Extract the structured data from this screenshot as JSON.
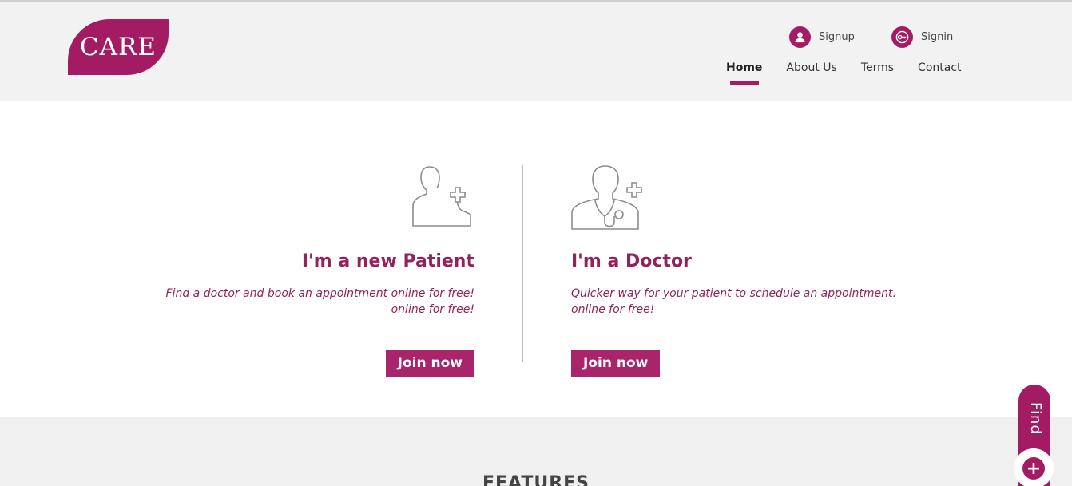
{
  "brand": {
    "logo_text": "CARE",
    "accent_color": "#a31c63"
  },
  "auth": {
    "signup_label": "Signup",
    "signin_label": "Signin",
    "signup_icon": "user-icon",
    "signin_icon": "key-icon"
  },
  "nav": {
    "items": [
      {
        "label": "Home",
        "active": true
      },
      {
        "label": "About Us",
        "active": false
      },
      {
        "label": "Terms",
        "active": false
      },
      {
        "label": "Contact",
        "active": false
      }
    ]
  },
  "patient": {
    "icon": "patient-add-icon",
    "title": "I'm a new Patient",
    "description_line1": "Find a doctor and book an appointment online for free!",
    "description_line2": "online for free!",
    "button_label": "Join now"
  },
  "doctor": {
    "icon": "doctor-add-icon",
    "title": "I'm a Doctor",
    "description_line1": "Quicker way for your patient to schedule an appointment.",
    "description_line2": "online for free!",
    "button_label": "Join now"
  },
  "features": {
    "title": "FEATURES"
  },
  "find_tab": {
    "label": "Find",
    "icon": "plus-icon"
  }
}
